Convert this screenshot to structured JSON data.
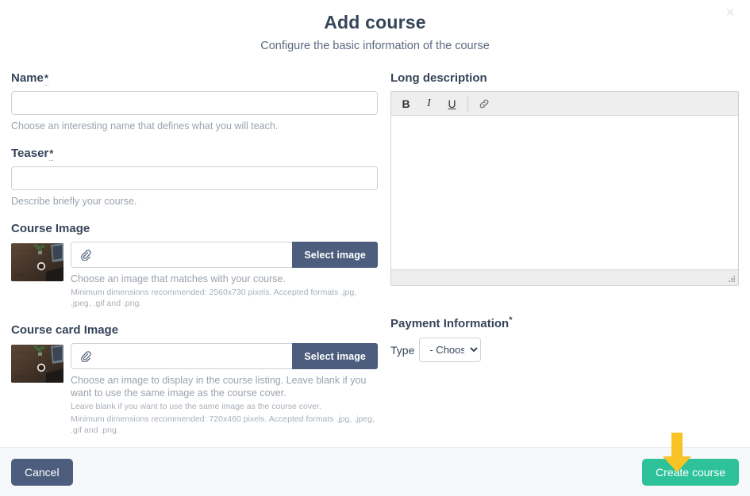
{
  "modal": {
    "title": "Add course",
    "subtitle": "Configure the basic information of the course",
    "close_icon": "close-icon",
    "close_label": "×"
  },
  "form": {
    "name": {
      "label": "Name",
      "required_marker": "*",
      "value": "",
      "placeholder": "",
      "help": "Choose an interesting name that defines what you will teach."
    },
    "teaser": {
      "label": "Teaser",
      "required_marker": "*",
      "value": "",
      "placeholder": "",
      "help": "Describe briefly your course."
    },
    "course_image": {
      "label": "Course Image",
      "attach_icon": "paperclip-icon",
      "value": "",
      "placeholder": "",
      "button_label": "Select image",
      "help": "Choose an image that matches with your course.",
      "help_small": "Minimum dimensions recommended: 2560x730 pixels. Accepted formats .jpg, .jpeg, .gif and .png."
    },
    "course_card_image": {
      "label": "Course card Image",
      "attach_icon": "paperclip-icon",
      "value": "",
      "placeholder": "",
      "button_label": "Select image",
      "help": "Choose an image to display in the course listing. Leave blank if you want to use the same image as the course cover.",
      "help_small_1": "Leave blank if you want to use the same image as the course cover.",
      "help_small_2": "Minimum dimensions recommended: 720x460 pixels. Accepted formats .jpg, .jpeg, .gif and .png."
    },
    "long_description": {
      "label": "Long description",
      "toolbar": {
        "bold": "B",
        "italic": "I",
        "underline": "U",
        "link_icon": "link-icon"
      },
      "content": ""
    },
    "payment": {
      "label": "Payment Information",
      "required_marker": "*",
      "type_label": "Type",
      "type_selected": "- Choose -",
      "type_options": [
        "- Choose -"
      ]
    }
  },
  "footer": {
    "cancel_label": "Cancel",
    "create_label": "Create course"
  },
  "annotation": {
    "arrow_icon": "arrow-down-icon",
    "arrow_color": "#f7c325",
    "points_to": "create-course-button"
  },
  "colors": {
    "heading": "#36445a",
    "primary_button": "#4c5d7d",
    "success_button": "#2ec29a",
    "help_text": "#9aa3ad",
    "border": "#ccd2da",
    "footer_bg": "#f7f8fa",
    "toolbar_bg": "#eeeeee"
  }
}
